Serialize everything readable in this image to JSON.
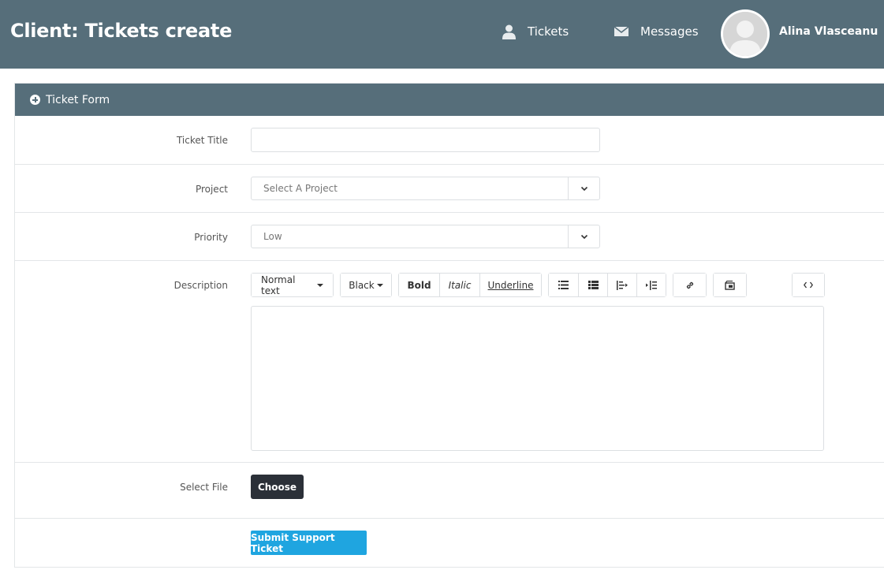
{
  "header": {
    "title": "Client: Tickets create",
    "nav": [
      {
        "label": "Tickets",
        "icon": "user-icon"
      },
      {
        "label": "Messages",
        "icon": "envelope-icon"
      }
    ],
    "user": {
      "name": "Alina Vlasceanu",
      "avatar": "avatar-placeholder"
    }
  },
  "panel": {
    "title": "Ticket Form",
    "icon": "plus-circle-icon"
  },
  "form": {
    "ticket_title": {
      "label": "Ticket Title",
      "value": ""
    },
    "project": {
      "label": "Project",
      "value": "Select A Project"
    },
    "priority": {
      "label": "Priority",
      "value": "Low"
    },
    "description": {
      "label": "Description",
      "toolbar": {
        "style": "Normal text",
        "color": "Black",
        "bold": "Bold",
        "italic": "Italic",
        "underline": "Underline"
      },
      "value": ""
    },
    "file": {
      "label": "Select File",
      "button": "Choose"
    },
    "submit": "Submit Support Ticket"
  },
  "colors": {
    "header_bg": "#566e7a",
    "primary": "#1fa5e0",
    "dark_button": "#2b3038"
  }
}
